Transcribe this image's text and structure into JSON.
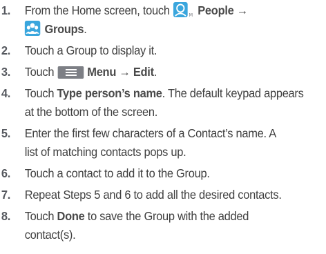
{
  "steps": [
    {
      "num": "1.",
      "a": "From the Home screen, touch ",
      "icon": "people-app-icon",
      "b1": "People",
      "arrow": " →",
      "l2_icon": "groups-icon",
      "b2": "Groups",
      "end": "."
    },
    {
      "num": "2.",
      "text": "Touch a Group to display it."
    },
    {
      "num": "3.",
      "a": "Touch ",
      "icon": "menu-key-icon",
      "b1": "Menu",
      "arrow": " → ",
      "b2": "Edit",
      "end": "."
    },
    {
      "num": "4.",
      "a": "Touch ",
      "b1": "Type person’s name",
      "c": ". The default keypad appears",
      "l2": "at the bottom of the screen."
    },
    {
      "num": "5.",
      "l1": "Enter the first few characters of a Contact’s name. A",
      "l2": "list of matching contacts pops up."
    },
    {
      "num": "6.",
      "text": "Touch a contact to add it to the Group."
    },
    {
      "num": "7.",
      "text": "Repeat Steps 5 and 6 to add all the desired contacts."
    },
    {
      "num": "8.",
      "a": "Touch ",
      "b1": "Done",
      "c": " to save the Group with the added",
      "l2": "contact(s)."
    }
  ],
  "colors": {
    "text": "#3f3f3f",
    "icon_blue": "#3aa6dd",
    "menu_key": "#7d7f85"
  }
}
